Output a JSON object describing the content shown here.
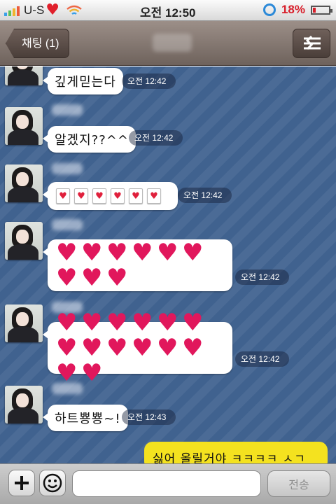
{
  "status_bar": {
    "carrier": "U-S",
    "time": "오전 12:50",
    "battery_percent": "18",
    "battery_unit": "%",
    "battery_level": 0.18,
    "heart_icon": "heart-icon",
    "wifi_icon": "wifi-icon"
  },
  "nav": {
    "back_label": "채팅 (1)",
    "title": "",
    "menu_icon": "settings-icon"
  },
  "messages": [
    {
      "text": "깊게믿는다",
      "time": "오전 12:42"
    },
    {
      "text": "알겠지??^^",
      "time": "오전 12:42"
    },
    {
      "hearts": 6,
      "time": "오전 12:42",
      "kind": "heart-cards"
    },
    {
      "hearts": 9,
      "time": "오전 12:42",
      "kind": "big-hearts"
    },
    {
      "hearts": 14,
      "time": "오전 12:42",
      "kind": "big-hearts"
    },
    {
      "text": "하트뿅뿅~!",
      "time": "오전 12:43"
    }
  ],
  "my_message": {
    "text": "싫어 올릴거야 ㅋㅋㅋㅋ ㅅㄱ"
  },
  "input_bar": {
    "placeholder": "",
    "send_label": "전송"
  },
  "colors": {
    "chat_background": "#40628f",
    "my_bubble": "#f4e21f",
    "heart": "#e1175c",
    "navbar": "#7f726c"
  }
}
